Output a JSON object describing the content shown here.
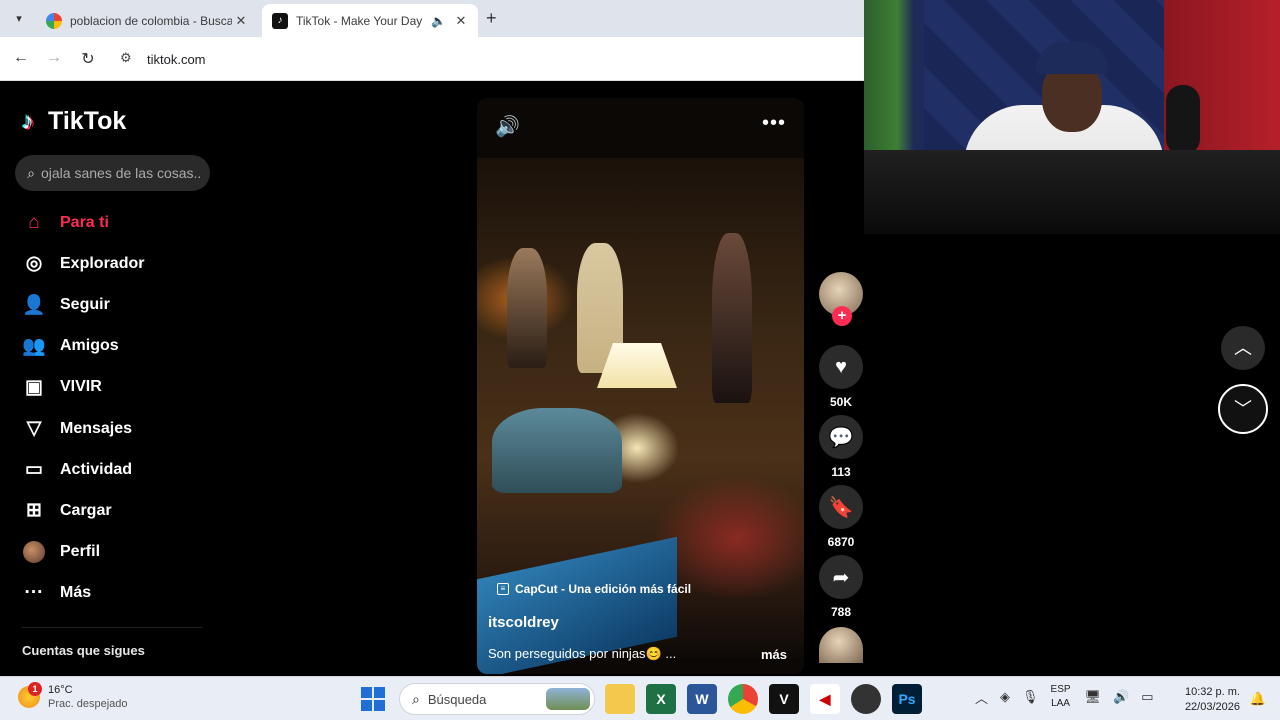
{
  "browser": {
    "tabs": [
      {
        "title": "poblacion de colombia - Buscar",
        "active": false
      },
      {
        "title": "TikTok - Make Your Day",
        "active": true
      }
    ],
    "url": "tiktok.com"
  },
  "sidebar": {
    "brand": "TikTok",
    "search_placeholder": "ojala sanes de las cosas...",
    "items": [
      {
        "label": "Para ti",
        "icon": "home-icon",
        "active": true
      },
      {
        "label": "Explorador",
        "icon": "compass-icon"
      },
      {
        "label": "Seguir",
        "icon": "follow-user-icon"
      },
      {
        "label": "Amigos",
        "icon": "friends-icon"
      },
      {
        "label": "VIVIR",
        "icon": "live-tv-icon"
      },
      {
        "label": "Mensajes",
        "icon": "send-icon"
      },
      {
        "label": "Actividad",
        "icon": "activity-icon"
      },
      {
        "label": "Cargar",
        "icon": "upload-icon"
      },
      {
        "label": "Perfil",
        "icon": "profile-avatar"
      },
      {
        "label": "Más",
        "icon": "more-dots-icon"
      }
    ],
    "following_heading": "Cuentas que sigues"
  },
  "video": {
    "watermark": "CapCut - Una edición más fácil",
    "author": "itscoldrey",
    "description": "Son perseguidos por ninjas😊 ...",
    "more_label": "más",
    "likes": "50K",
    "comments": "113",
    "saves": "6870",
    "shares": "788"
  },
  "taskbar": {
    "weather_temp": "16°C",
    "weather_desc": "Prac. despejado",
    "weather_badge": "1",
    "search_label": "Búsqueda",
    "lang_top": "ESP",
    "lang_bottom": "LAA",
    "time": "10:32 p. m.",
    "date": "22/03/2026"
  },
  "colors": {
    "accent": "#fe2c55",
    "background": "#000000"
  }
}
